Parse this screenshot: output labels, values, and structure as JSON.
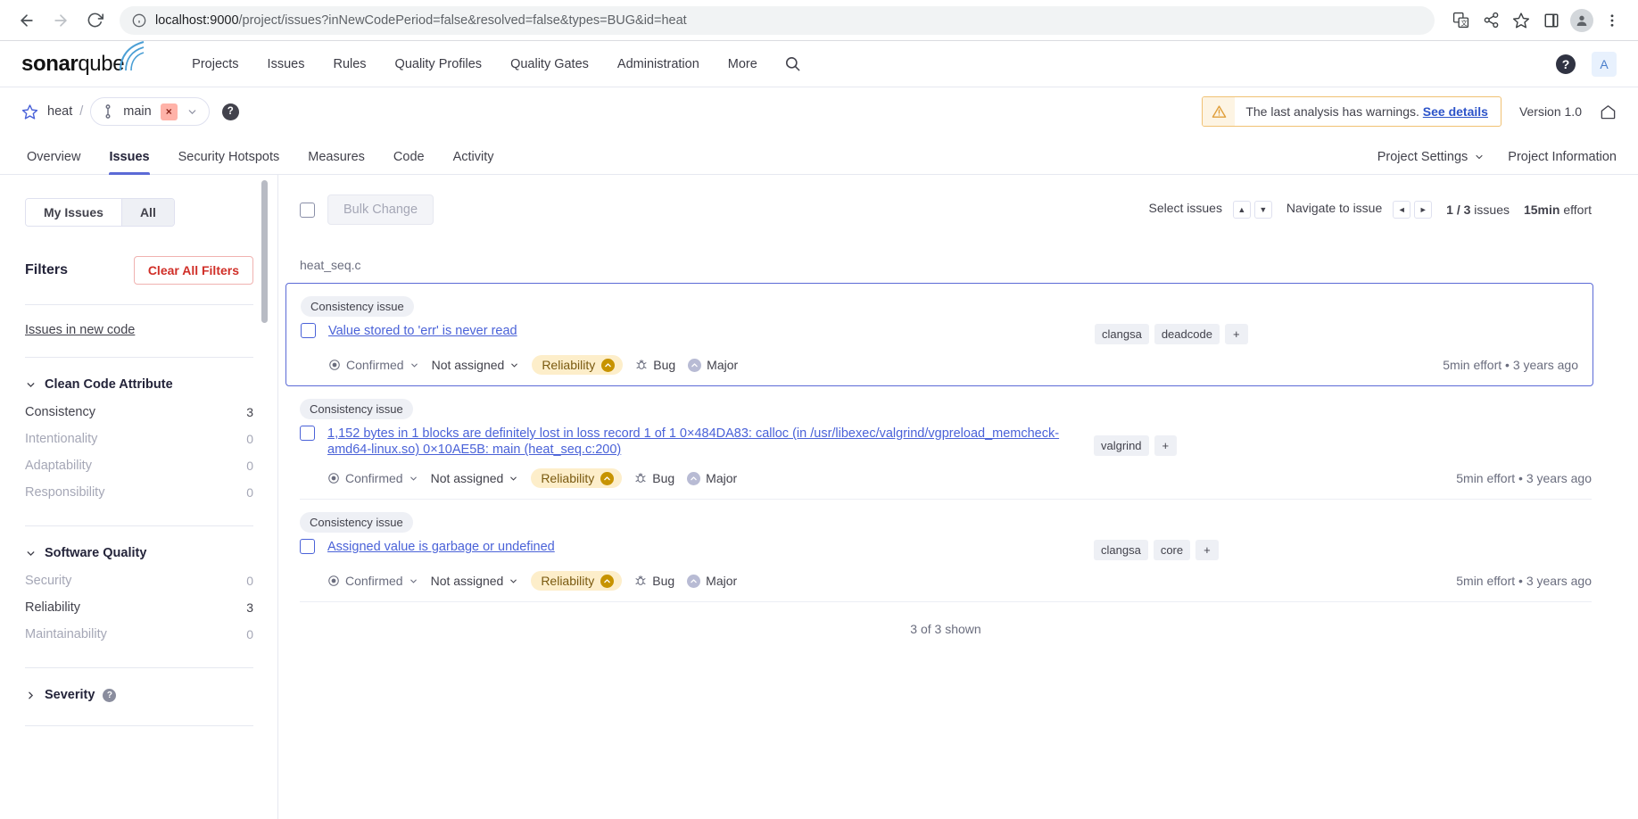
{
  "browser": {
    "back_label": "Back",
    "forward_label": "Forward",
    "reload_label": "Reload",
    "url_host": "localhost:9000",
    "url_rest": "/project/issues?inNewCodePeriod=false&resolved=false&types=BUG&id=heat",
    "icons": [
      "translate-icon",
      "share-icon",
      "bookmark-star-icon",
      "side-panel-icon",
      "profile-avatar-icon",
      "more-menu-icon"
    ]
  },
  "global_nav": {
    "logo_bold": "sonar",
    "logo_light": "qube",
    "menu": [
      {
        "label": "Projects"
      },
      {
        "label": "Issues"
      },
      {
        "label": "Rules"
      },
      {
        "label": "Quality Profiles"
      },
      {
        "label": "Quality Gates"
      },
      {
        "label": "Administration"
      },
      {
        "label": "More"
      }
    ],
    "search_icon": "search-icon",
    "help_label": "?",
    "user_initial": "A"
  },
  "project_header": {
    "favorite_icon": "star-outline-icon",
    "project_name": "heat",
    "separator": "/",
    "branch_name": "main",
    "branch_status_badge": "×",
    "branch_help": "?",
    "warning_text": "The last analysis has warnings.",
    "warning_link": "See details",
    "version": "Version 1.0",
    "home_icon": "home-icon"
  },
  "tabs": [
    {
      "label": "Overview",
      "active": false
    },
    {
      "label": "Issues",
      "active": true
    },
    {
      "label": "Security Hotspots",
      "active": false
    },
    {
      "label": "Measures",
      "active": false
    },
    {
      "label": "Code",
      "active": false
    },
    {
      "label": "Activity",
      "active": false
    }
  ],
  "tabs_right": [
    {
      "label": "Project Settings",
      "has_chevron": true
    },
    {
      "label": "Project Information",
      "has_chevron": false
    }
  ],
  "sidebar": {
    "scope_toggle": {
      "my_issues": "My Issues",
      "all": "All",
      "selected": "All"
    },
    "filters_title": "Filters",
    "clear_all_label": "Clear All Filters",
    "new_code_link": "Issues in new code",
    "facets": [
      {
        "title": "Clean Code Attribute",
        "expanded": true,
        "items": [
          {
            "label": "Consistency",
            "count": "3",
            "active": true
          },
          {
            "label": "Intentionality",
            "count": "0",
            "active": false
          },
          {
            "label": "Adaptability",
            "count": "0",
            "active": false
          },
          {
            "label": "Responsibility",
            "count": "0",
            "active": false
          }
        ]
      },
      {
        "title": "Software Quality",
        "expanded": true,
        "items": [
          {
            "label": "Security",
            "count": "0",
            "active": false
          },
          {
            "label": "Reliability",
            "count": "3",
            "active": true
          },
          {
            "label": "Maintainability",
            "count": "0",
            "active": false
          }
        ]
      },
      {
        "title": "Severity",
        "expanded": false,
        "has_help": true,
        "items": []
      }
    ]
  },
  "issues_toolbar": {
    "select_all_checkbox": "unchecked",
    "bulk_change_label": "Bulk Change",
    "select_issues_label": "Select issues",
    "select_keys": [
      "▲",
      "▼"
    ],
    "navigate_label": "Navigate to issue",
    "navigate_keys": [
      "◄",
      "►"
    ],
    "counter": "1 / 3 issues",
    "counter_bold": "1 / 3",
    "counter_rest": " issues",
    "effort_bold": "15min",
    "effort_rest": " effort"
  },
  "issues": {
    "file_label": "heat_seq.c",
    "items": [
      {
        "attribute_badge": "Consistency issue",
        "title": "Value stored to 'err' is never read",
        "tags": [
          "clangsa",
          "deadcode"
        ],
        "add_tag": "+",
        "status": "Confirmed",
        "assignee": "Not assigned",
        "quality": "Reliability",
        "type": "Bug",
        "severity": "Major",
        "effort": "5min effort",
        "age": "3 years ago",
        "selected": true
      },
      {
        "attribute_badge": "Consistency issue",
        "title": "1,152 bytes in 1 blocks are definitely lost in loss record 1 of 1 0×484DA83: calloc (in /usr/libexec/valgrind/vgpreload_memcheck-amd64-linux.so) 0×10AE5B: main (heat_seq.c:200)",
        "tags": [
          "valgrind"
        ],
        "add_tag": "+",
        "status": "Confirmed",
        "assignee": "Not assigned",
        "quality": "Reliability",
        "type": "Bug",
        "severity": "Major",
        "effort": "5min effort",
        "age": "3 years ago",
        "selected": false
      },
      {
        "attribute_badge": "Consistency issue",
        "title": "Assigned value is garbage or undefined",
        "tags": [
          "clangsa",
          "core"
        ],
        "add_tag": "+",
        "status": "Confirmed",
        "assignee": "Not assigned",
        "quality": "Reliability",
        "type": "Bug",
        "severity": "Major",
        "effort": "5min effort",
        "age": "3 years ago",
        "selected": false
      }
    ],
    "separator_dot": "•",
    "footer": "3 of 3 shown"
  },
  "colors": {
    "accent_blue": "#4a62d8",
    "tab_underline": "#5b6ad6",
    "warning_border": "#f0c173",
    "danger_red": "#d02f28",
    "reliability_bg": "#fdeeca"
  }
}
